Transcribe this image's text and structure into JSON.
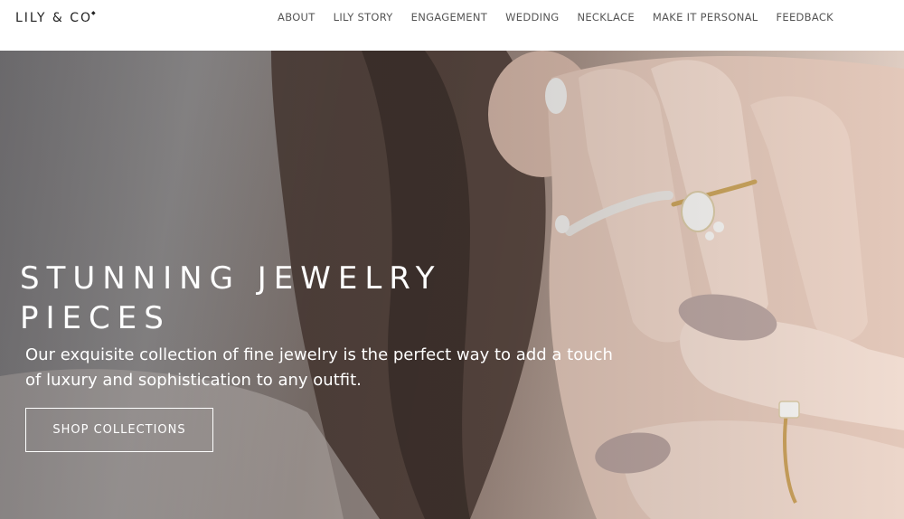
{
  "brand": {
    "name": "LILY & CO",
    "mark": "◆"
  },
  "nav": {
    "items": [
      {
        "label": "ABOUT"
      },
      {
        "label": "LILY STORY"
      },
      {
        "label": "ENGAGEMENT"
      },
      {
        "label": "WEDDING"
      },
      {
        "label": "NECKLACE"
      },
      {
        "label": "MAKE IT PERSONAL"
      },
      {
        "label": "FEEDBACK"
      }
    ]
  },
  "hero": {
    "title": "STUNNING JEWELRY PIECES",
    "text": "Our exquisite collection of fine jewelry is the perfect way to add a touch of luxury and sophistication to any outfit.",
    "cta_label": "SHOP COLLECTIONS"
  }
}
